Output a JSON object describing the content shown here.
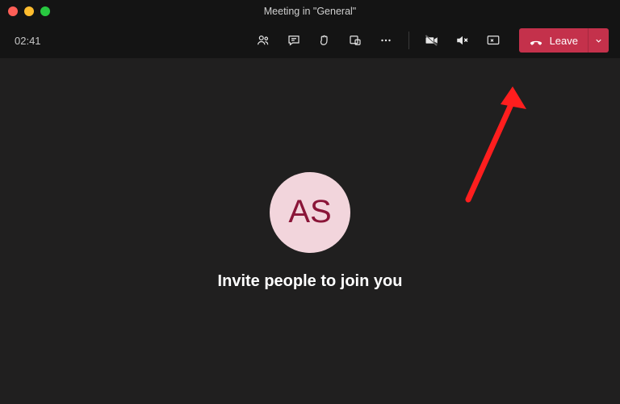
{
  "window": {
    "title": "Meeting in \"General\""
  },
  "toolbar": {
    "timer": "02:41",
    "leave_label": "Leave"
  },
  "avatar": {
    "initials": "AS"
  },
  "prompt": "Invite people to join you"
}
